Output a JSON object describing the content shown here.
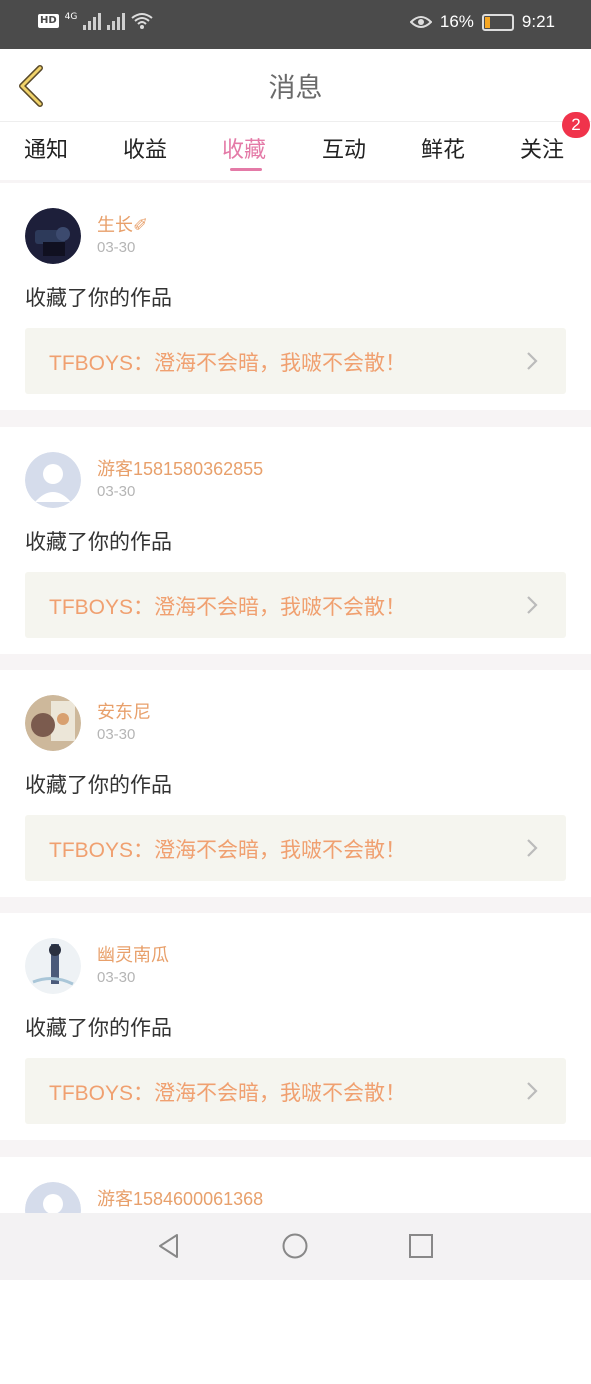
{
  "status_bar": {
    "hd": "HD",
    "network": "4G",
    "battery": "16%",
    "time": "9:21"
  },
  "header": {
    "title": "消息"
  },
  "tabs": [
    {
      "label": "通知"
    },
    {
      "label": "收益"
    },
    {
      "label": "收藏"
    },
    {
      "label": "互动"
    },
    {
      "label": "鲜花"
    },
    {
      "label": "关注"
    }
  ],
  "active_tab": "收藏",
  "follow_badge": "2",
  "colors": {
    "accent": "#e47aa7",
    "username": "#e8a06b",
    "work_title": "#f0a070",
    "badge": "#f0334b"
  },
  "notifications": [
    {
      "user": "生长✐",
      "date": "03-30",
      "action": "收藏了你的作品",
      "work": "TFBOYS：澄海不会暗，我啵不会散！",
      "avatar": "photo-dark"
    },
    {
      "user": "游客1581580362855",
      "date": "03-30",
      "action": "收藏了你的作品",
      "work": "TFBOYS：澄海不会暗，我啵不会散！",
      "avatar": "default-user"
    },
    {
      "user": "安东尼",
      "date": "03-30",
      "action": "收藏了你的作品",
      "work": "TFBOYS：澄海不会暗，我啵不会散！",
      "avatar": "photo-light"
    },
    {
      "user": "幽灵南瓜",
      "date": "03-30",
      "action": "收藏了你的作品",
      "work": "TFBOYS：澄海不会暗，我啵不会散！",
      "avatar": "photo-white"
    },
    {
      "user": "游客1584600061368",
      "date": "",
      "action": "",
      "work": "",
      "avatar": "default-user"
    }
  ]
}
